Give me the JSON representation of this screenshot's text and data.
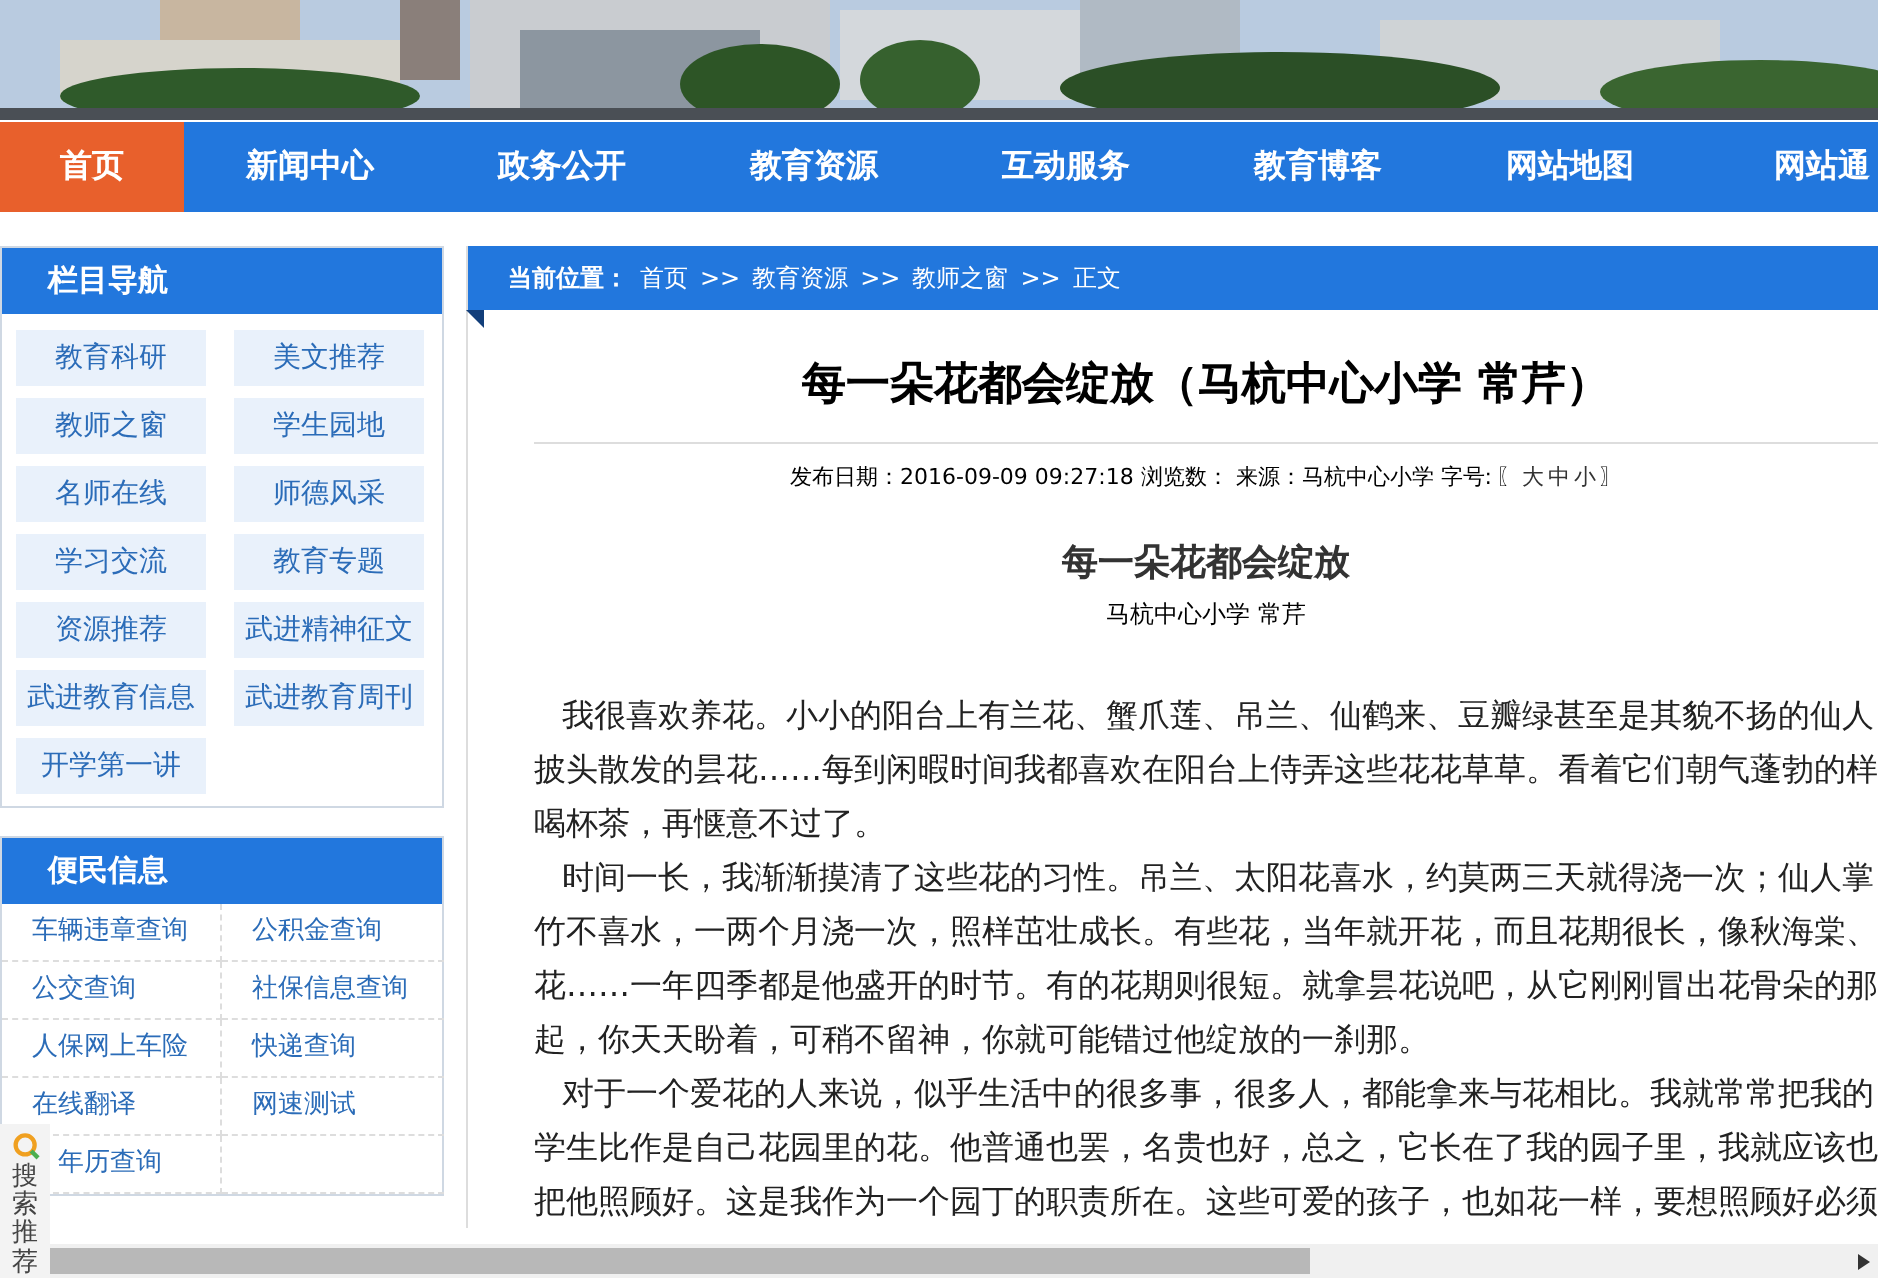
{
  "nav": [
    {
      "label": "首页",
      "selected": true
    },
    {
      "label": "新闻中心",
      "selected": false
    },
    {
      "label": "政务公开",
      "selected": false
    },
    {
      "label": "教育资源",
      "selected": false
    },
    {
      "label": "互动服务",
      "selected": false
    },
    {
      "label": "教育博客",
      "selected": false
    },
    {
      "label": "网站地图",
      "selected": false
    },
    {
      "label": "网站通",
      "selected": false
    }
  ],
  "sidebar": {
    "column_nav": {
      "title": "栏目导航",
      "items": [
        "教育科研",
        "美文推荐",
        "教师之窗",
        "学生园地",
        "名师在线",
        "师德风采",
        "学习交流",
        "教育专题",
        "资源推荐",
        "武进精神征文",
        "武进教育信息",
        "武进教育周刊",
        "开学第一讲"
      ]
    },
    "services": {
      "title": "便民信息",
      "items": [
        "车辆违章查询",
        "公积金查询",
        "公交查询",
        "社保信息查询",
        "人保网上车险",
        "快递查询",
        "在线翻译",
        "网速测试",
        "年历查询"
      ]
    }
  },
  "breadcrumb": {
    "label": "当前位置：",
    "links": [
      "首页",
      "教育资源",
      "教师之窗",
      "正文"
    ],
    "separators": [
      ">>",
      ">>",
      ">>"
    ]
  },
  "article": {
    "title": "每一朵花都会绽放（马杭中心小学 常芹）",
    "meta": "发布日期：2016-09-09 09:27:18 浏览数：  来源：马杭中心小学 字号:",
    "size_open": "〖",
    "size_links": [
      "大",
      "中",
      "小"
    ],
    "size_close": "〗",
    "heading": "每一朵花都会绽放",
    "author": "马杭中心小学 常芹",
    "paragraphs": [
      {
        "lines": [
          "我很喜欢养花。小小的阳台上有兰花、蟹爪莲、吊兰、仙鹤来、豆瓣绿甚至是其貌不扬的仙人",
          "披头散发的昙花……每到闲暇时间我都喜欢在阳台上侍弄这些花花草草。看着它们朝气蓬勃的样",
          "喝杯茶，再惬意不过了。"
        ]
      },
      {
        "lines": [
          "时间一长，我渐渐摸清了这些花的习性。吊兰、太阳花喜水，约莫两三天就得浇一次；仙人掌",
          "竹不喜水，一两个月浇一次，照样茁壮成长。有些花，当年就开花，而且花期很长，像秋海棠、",
          "花……一年四季都是他盛开的时节。有的花期则很短。就拿昙花说吧，从它刚刚冒出花骨朵的那",
          "起，你天天盼着，可稍不留神，你就可能错过他绽放的一刹那。"
        ]
      },
      {
        "lines": [
          "对于一个爱花的人来说，似乎生活中的很多事，很多人，都能拿来与花相比。我就常常把我的",
          "学生比作是自己花园里的花。他普通也罢，名贵也好，总之，它长在了我的园子里，我就应该也",
          "把他照顾好。这是我作为一个园丁的职责所在。这些可爱的孩子，也如花一样，要想照顾好必须"
        ]
      }
    ]
  },
  "search_widget": {
    "label": "搜索推荐"
  }
}
